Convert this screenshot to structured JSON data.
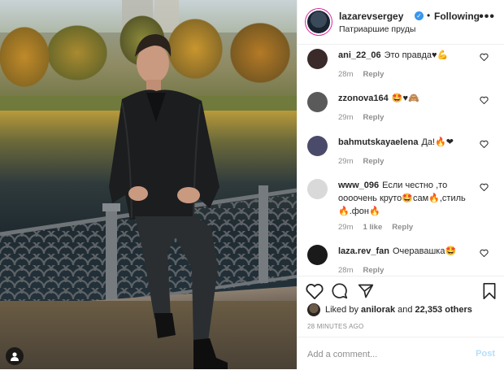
{
  "header": {
    "username": "lazarevsergey",
    "separator": "•",
    "follow_label": "Following",
    "location": "Патриаршие пруды",
    "more": "•••"
  },
  "comments": [
    {
      "user": "ani_22_06",
      "text": "Это правда♥💪",
      "time": "28m",
      "reply": "Reply",
      "likes": "",
      "avatar_color": "#3a2a2a"
    },
    {
      "user": "zzonova164",
      "text": "🤩♥🙈",
      "time": "29m",
      "reply": "Reply",
      "likes": "",
      "avatar_color": "#5a5a5a"
    },
    {
      "user": "bahmutskayaelena",
      "text": "Да!🔥❤",
      "time": "29m",
      "reply": "Reply",
      "likes": "",
      "avatar_color": "#4a4a6a"
    },
    {
      "user": "www_096",
      "text": "Если честно ,то оооочень круто🤩сам🔥,стиль🔥.фон🔥",
      "time": "29m",
      "reply": "Reply",
      "likes": "1 like",
      "avatar_color": "#d9d9d9"
    },
    {
      "user": "laza.rev_fan",
      "text": "Очеравашка🤩",
      "time": "28m",
      "reply": "Reply",
      "likes": "",
      "avatar_color": "#1a1a1a"
    }
  ],
  "likes": {
    "prefix": "Liked by",
    "user": "anilorak",
    "and": "and",
    "count": "22,353 others"
  },
  "timestamp": "28 MINUTES AGO",
  "add_comment": {
    "placeholder": "Add a comment...",
    "post_label": "Post"
  },
  "colors": {
    "verified": "#3897f0",
    "post_disabled": "#b2dffc",
    "meta_grey": "#8e8e8e"
  },
  "icons": [
    "heart-icon",
    "comment-icon",
    "share-icon",
    "bookmark-icon",
    "user-tag-icon",
    "more-icon",
    "verified-icon"
  ]
}
